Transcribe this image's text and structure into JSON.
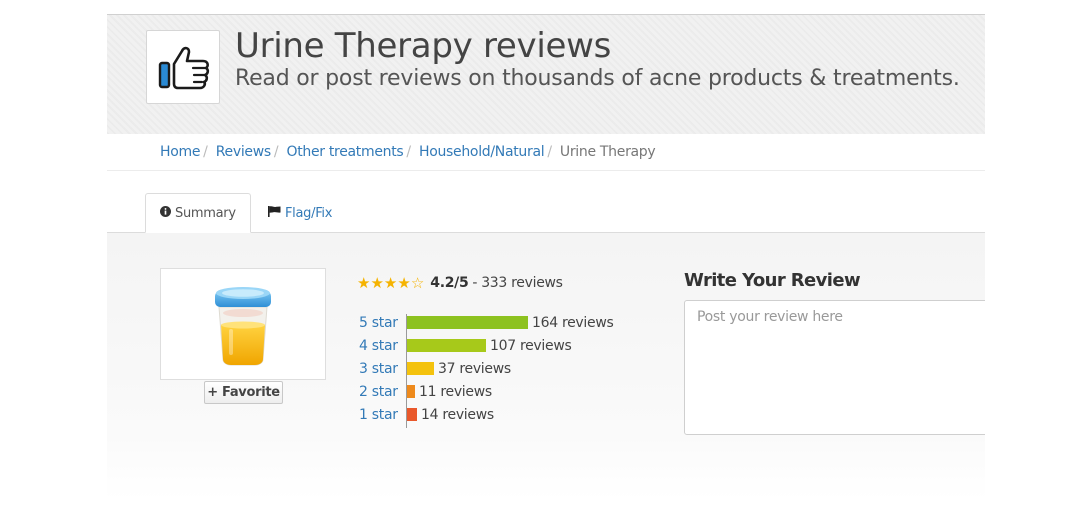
{
  "header": {
    "title": "Urine Therapy reviews",
    "subtitle": "Read or post reviews on thousands of acne products & treatments."
  },
  "breadcrumb": [
    "Home",
    "Reviews",
    "Other treatments",
    "Household/Natural",
    "Urine Therapy"
  ],
  "tabs": [
    {
      "label": "Summary",
      "icon": "info-circle-icon",
      "active": true
    },
    {
      "label": "Flag/Fix",
      "icon": "flag-icon",
      "active": false
    }
  ],
  "product": {
    "favorite_label": "+ Favorite"
  },
  "rating": {
    "stars_full": 4,
    "stars_total": 5,
    "score": "4.2/5",
    "separator": "-",
    "count_text": "333 reviews"
  },
  "distribution": [
    {
      "label": "5 star",
      "count": 164,
      "count_text": "164 reviews",
      "color": "#8dc21f"
    },
    {
      "label": "4 star",
      "count": 107,
      "count_text": "107 reviews",
      "color": "#a7c91a"
    },
    {
      "label": "3 star",
      "count": 37,
      "count_text": "37 reviews",
      "color": "#f4c20d"
    },
    {
      "label": "2 star",
      "count": 11,
      "count_text": "11 reviews",
      "color": "#ee8a1c"
    },
    {
      "label": "1 star",
      "count": 14,
      "count_text": "14 reviews",
      "color": "#e9582b"
    }
  ],
  "write_review": {
    "title": "Write Your Review",
    "placeholder": "Post your review here"
  },
  "colors": {
    "link": "#337ab7",
    "star": "#f5b301"
  }
}
